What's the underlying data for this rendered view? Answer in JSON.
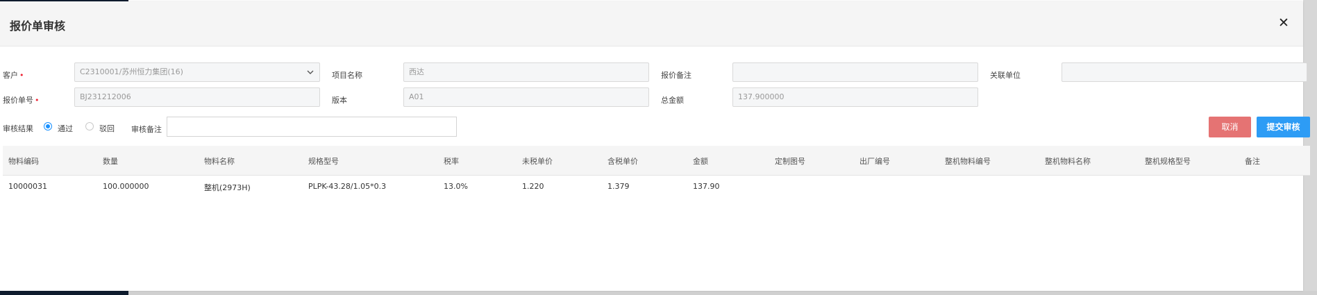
{
  "dialog": {
    "title": "报价单审核",
    "close": "✕"
  },
  "form": {
    "customer": {
      "label": "客户",
      "value": "C2310001/苏州恒力集团(16)"
    },
    "project_name": {
      "label": "项目名称",
      "value": "西达"
    },
    "quote_remark": {
      "label": "报价备注",
      "value": ""
    },
    "related_unit": {
      "label": "关联单位",
      "value": ""
    },
    "quote_no": {
      "label": "报价单号",
      "value": "BJ231212006"
    },
    "version": {
      "label": "版本",
      "value": "A01"
    },
    "total_amount": {
      "label": "总金额",
      "value": "137.900000"
    },
    "required_mark": "•"
  },
  "review": {
    "result_label": "审核结果",
    "pass_label": "通过",
    "reject_label": "驳回",
    "selected": "pass",
    "remark_label": "审核备注",
    "remark_value": ""
  },
  "buttons": {
    "cancel": "取消",
    "submit": "提交审核"
  },
  "table": {
    "columns": [
      "物料编码",
      "数量",
      "物料名称",
      "规格型号",
      "税率",
      "未税单价",
      "含税单价",
      "金额",
      "定制图号",
      "出厂编号",
      "整机物料编号",
      "整机物料名称",
      "整机规格型号",
      "备注"
    ],
    "rows": [
      [
        "10000031",
        "100.000000",
        "整机(2973H)",
        "PLPK-43.28/1.05*0.3",
        "13.0%",
        "1.220",
        "1.379",
        "137.90",
        "",
        "",
        "",
        "",
        "",
        ""
      ]
    ]
  },
  "colors": {
    "accent": "#2d9cf5",
    "danger": "#e57373",
    "radio_active": "#1890ff"
  }
}
